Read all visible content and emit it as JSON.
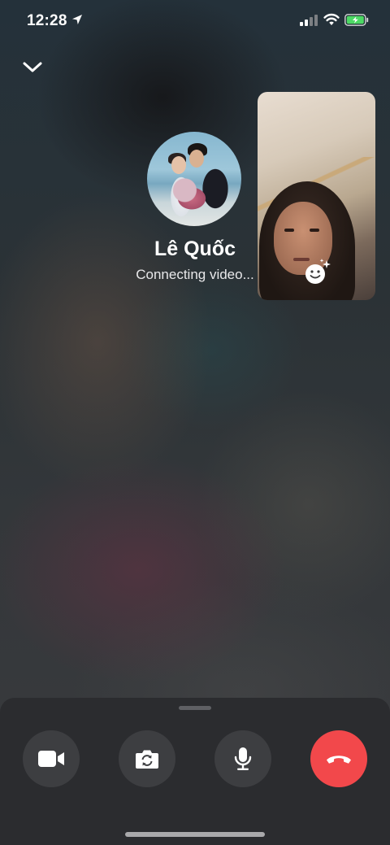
{
  "status_bar": {
    "time": "12:28",
    "icons": [
      "location-arrow-icon",
      "cellular-signal-icon",
      "wifi-icon",
      "battery-charging-icon"
    ]
  },
  "header": {
    "minimize_icon": "chevron-down-icon"
  },
  "caller": {
    "name": "Lê Quốc",
    "status": "Connecting video..."
  },
  "self_view": {
    "effects_icon": "smiley-sparkle-icon"
  },
  "controls": [
    {
      "name": "video-toggle-button",
      "icon": "video-camera-icon"
    },
    {
      "name": "flip-camera-button",
      "icon": "camera-flip-icon"
    },
    {
      "name": "mute-button",
      "icon": "microphone-icon"
    },
    {
      "name": "end-call-button",
      "icon": "phone-hangup-icon"
    }
  ],
  "colors": {
    "end_call": "#f2484b",
    "control_bg": "#3d3e41",
    "panel_bg": "#2b2c2f",
    "battery_fill": "#4cd964"
  }
}
